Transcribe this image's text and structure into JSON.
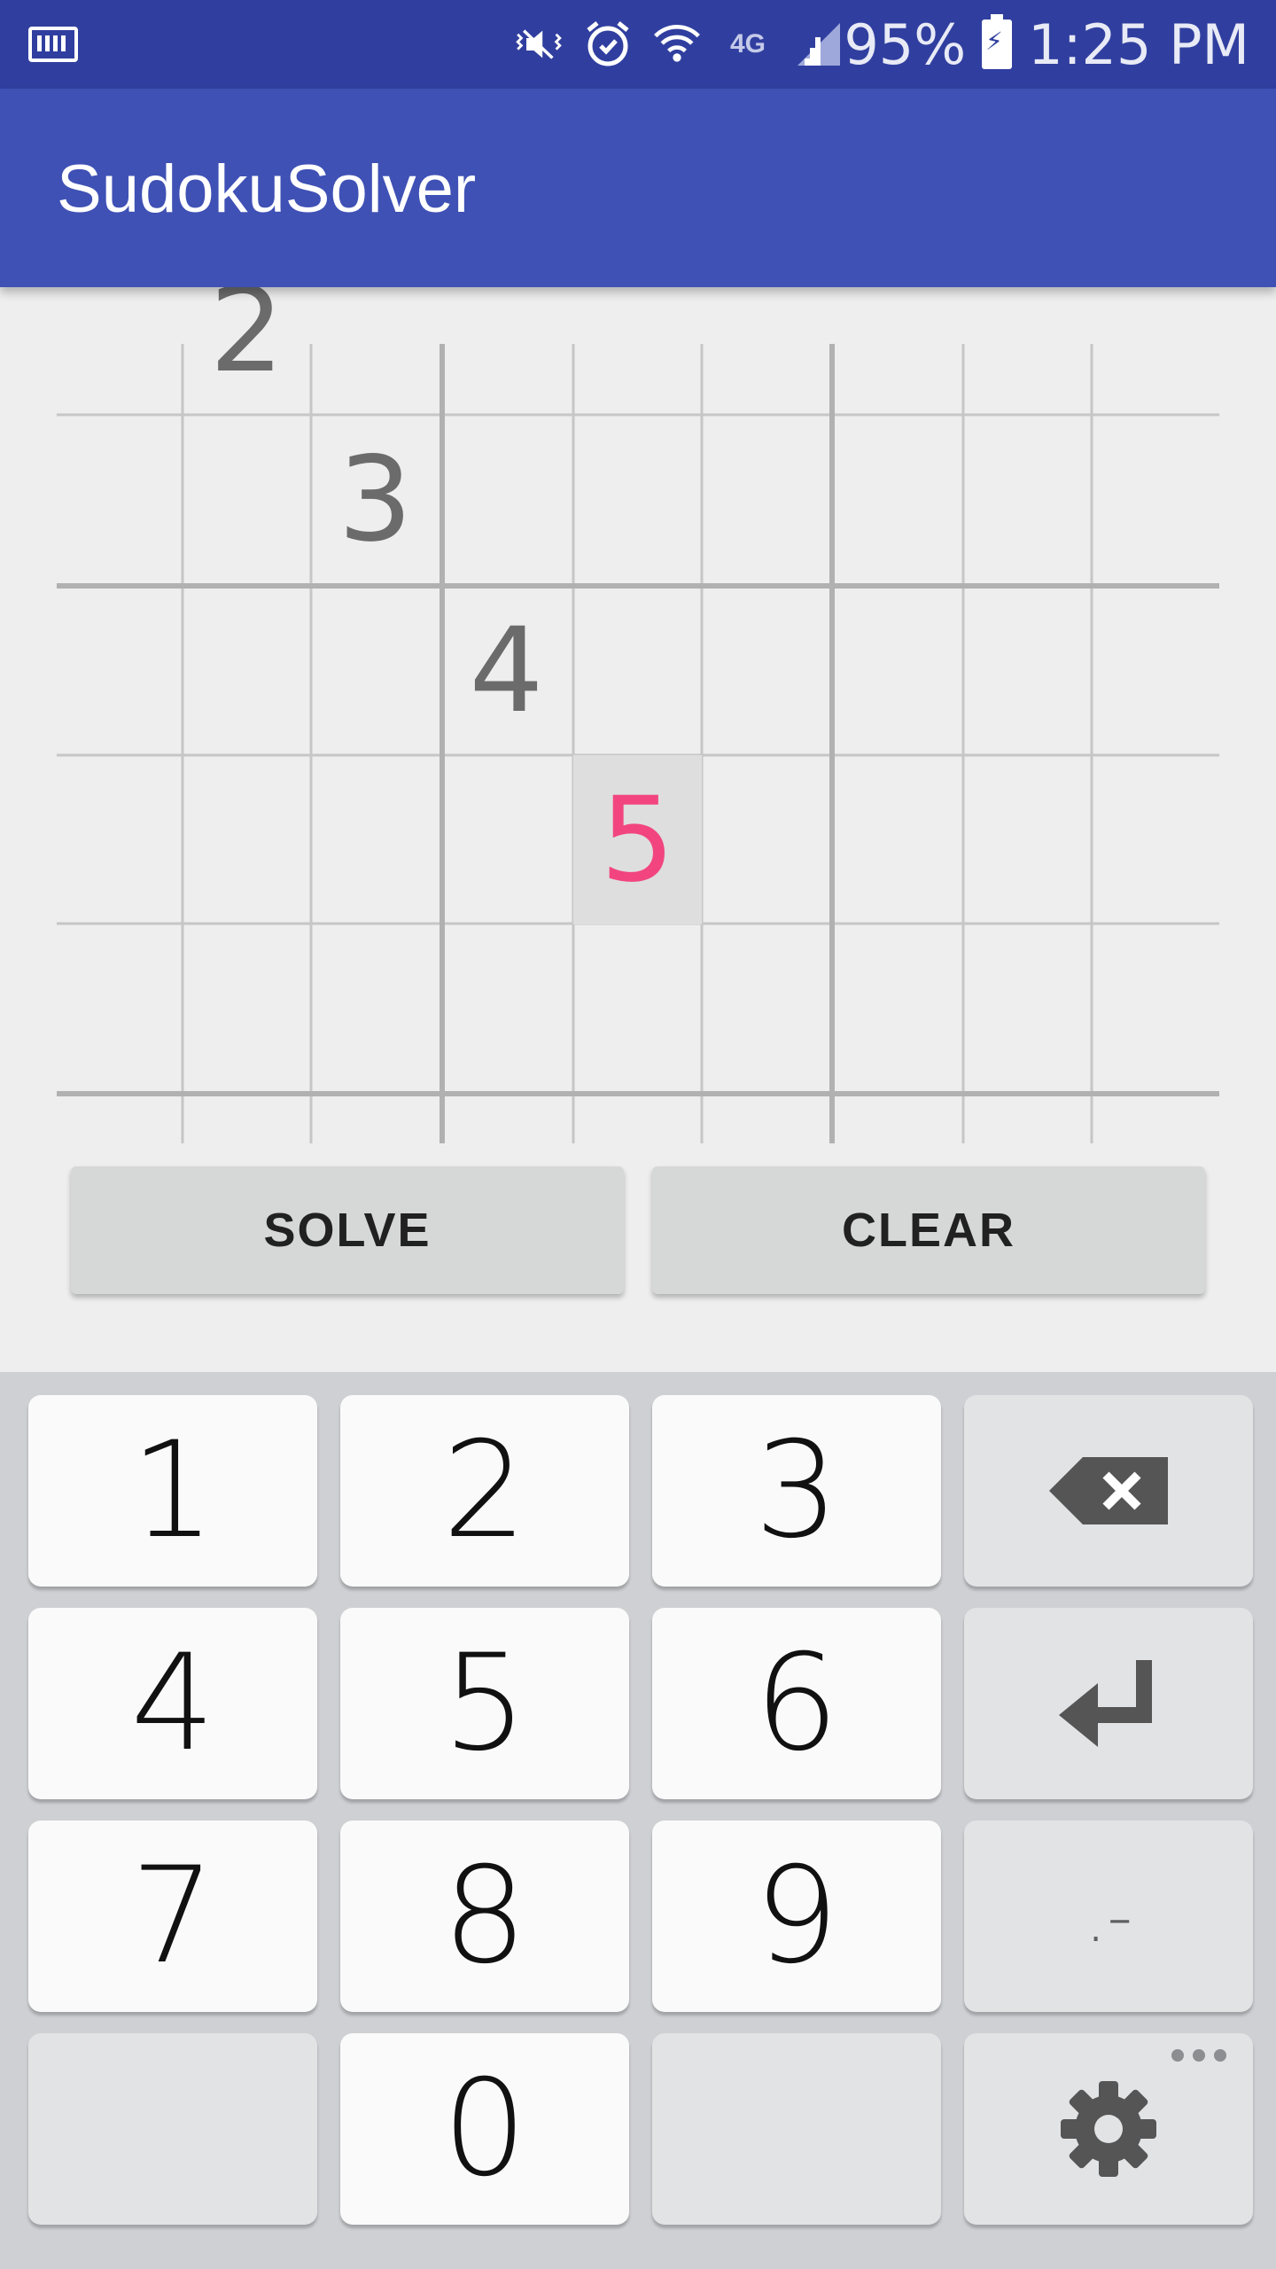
{
  "status_bar": {
    "battery": "95%",
    "time": "1:25 PM",
    "network": "4G",
    "icons": [
      "keyboard-icon",
      "vibrate-mute-icon",
      "alarm-icon",
      "wifi-icon",
      "signal-icon",
      "battery-charging-icon"
    ]
  },
  "app": {
    "title": "SudokuSolver"
  },
  "grid": {
    "cells": [
      {
        "text": "2",
        "row": 0,
        "col": 1,
        "selected": false
      },
      {
        "text": "3",
        "row": 1,
        "col": 2,
        "selected": false
      },
      {
        "text": "4",
        "row": 2,
        "col": 3,
        "selected": false
      },
      {
        "text": "5",
        "row": 3,
        "col": 4,
        "selected": true
      }
    ]
  },
  "actions": {
    "solve": "SOLVE",
    "clear": "CLEAR"
  },
  "keyboard": {
    "keys": [
      "1",
      "2",
      "3",
      "4",
      "5",
      "6",
      "7",
      "8",
      "9",
      "0"
    ],
    "period_dash": ".-"
  },
  "colors": {
    "primary": "#3f51b5",
    "primary_dark": "#303f9f",
    "selected_digit": "#f2457f"
  }
}
